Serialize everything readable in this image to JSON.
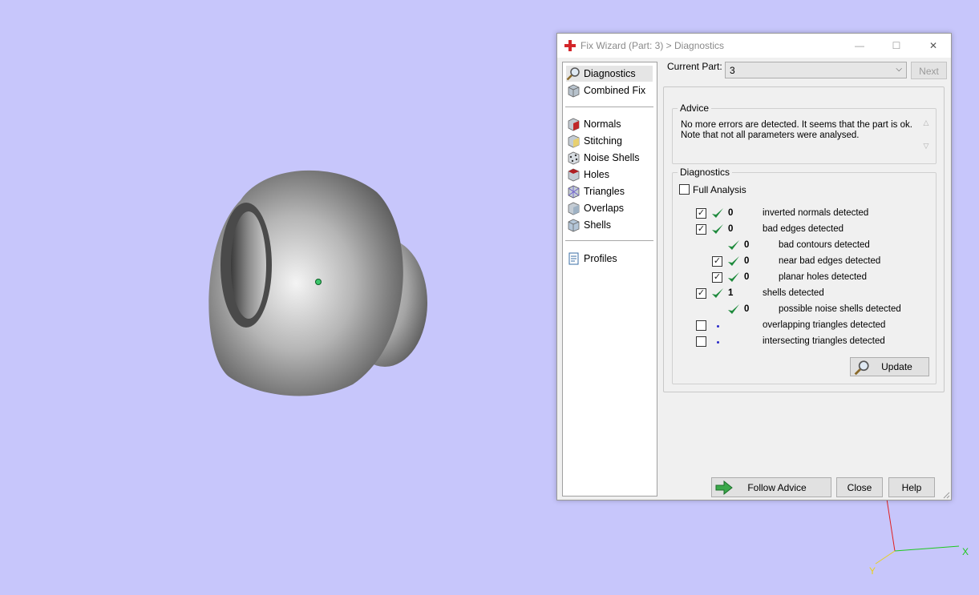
{
  "viewport": {
    "axis_x_label": "X",
    "axis_y_label": "Y",
    "background_color": "#c7c6fb"
  },
  "dialog": {
    "title": "Fix Wizard (Part: 3) > Diagnostics",
    "minimize_glyph": "—",
    "maximize_glyph": "☐",
    "close_glyph": "✕"
  },
  "nav": {
    "items": [
      {
        "label": "Diagnostics",
        "icon": "magnifier-icon"
      },
      {
        "label": "Combined Fix",
        "icon": "combined-fix-icon"
      },
      {
        "label": "Normals",
        "icon": "normals-icon"
      },
      {
        "label": "Stitching",
        "icon": "stitching-icon"
      },
      {
        "label": "Noise Shells",
        "icon": "noise-shells-icon"
      },
      {
        "label": "Holes",
        "icon": "holes-icon"
      },
      {
        "label": "Triangles",
        "icon": "triangles-icon"
      },
      {
        "label": "Overlaps",
        "icon": "overlaps-icon"
      },
      {
        "label": "Shells",
        "icon": "shells-icon"
      },
      {
        "label": "Profiles",
        "icon": "profiles-icon"
      }
    ]
  },
  "current_part": {
    "label": "Current Part:",
    "value": "3",
    "next_label": "Next"
  },
  "advice": {
    "title": "Advice",
    "line1": "No more errors are detected. It seems that the part is ok.",
    "line2": "Note that not all parameters were analysed."
  },
  "diagnostics": {
    "title": "Diagnostics",
    "full_analysis_label": "Full Analysis",
    "full_analysis_checked": false,
    "rows": [
      {
        "checkbox": true,
        "checked": true,
        "status": "ok",
        "count": "0",
        "label": "inverted normals detected",
        "indent": 0
      },
      {
        "checkbox": true,
        "checked": true,
        "status": "ok",
        "count": "0",
        "label": "bad edges detected",
        "indent": 0
      },
      {
        "checkbox": false,
        "checked": false,
        "status": "ok",
        "count": "0",
        "label": "bad contours detected",
        "indent": 1
      },
      {
        "checkbox": true,
        "checked": true,
        "status": "ok",
        "count": "0",
        "label": "near bad edges detected",
        "indent": 1
      },
      {
        "checkbox": true,
        "checked": true,
        "status": "ok",
        "count": "0",
        "label": "planar holes detected",
        "indent": 1
      },
      {
        "checkbox": true,
        "checked": true,
        "status": "ok",
        "count": "1",
        "label": "shells detected",
        "indent": 0
      },
      {
        "checkbox": false,
        "checked": false,
        "status": "ok",
        "count": "0",
        "label": "possible noise shells detected",
        "indent": 1
      },
      {
        "checkbox": true,
        "checked": false,
        "status": "pending",
        "count": "",
        "label": "overlapping triangles detected",
        "indent": 0
      },
      {
        "checkbox": true,
        "checked": false,
        "status": "pending",
        "count": "",
        "label": "intersecting triangles detected",
        "indent": 0
      }
    ],
    "update_label": "Update"
  },
  "footer": {
    "follow_advice_label": "Follow Advice",
    "close_label": "Close",
    "help_label": "Help"
  },
  "colors": {
    "check_green": "#1e8a3c",
    "accent_red": "#d3262a"
  }
}
